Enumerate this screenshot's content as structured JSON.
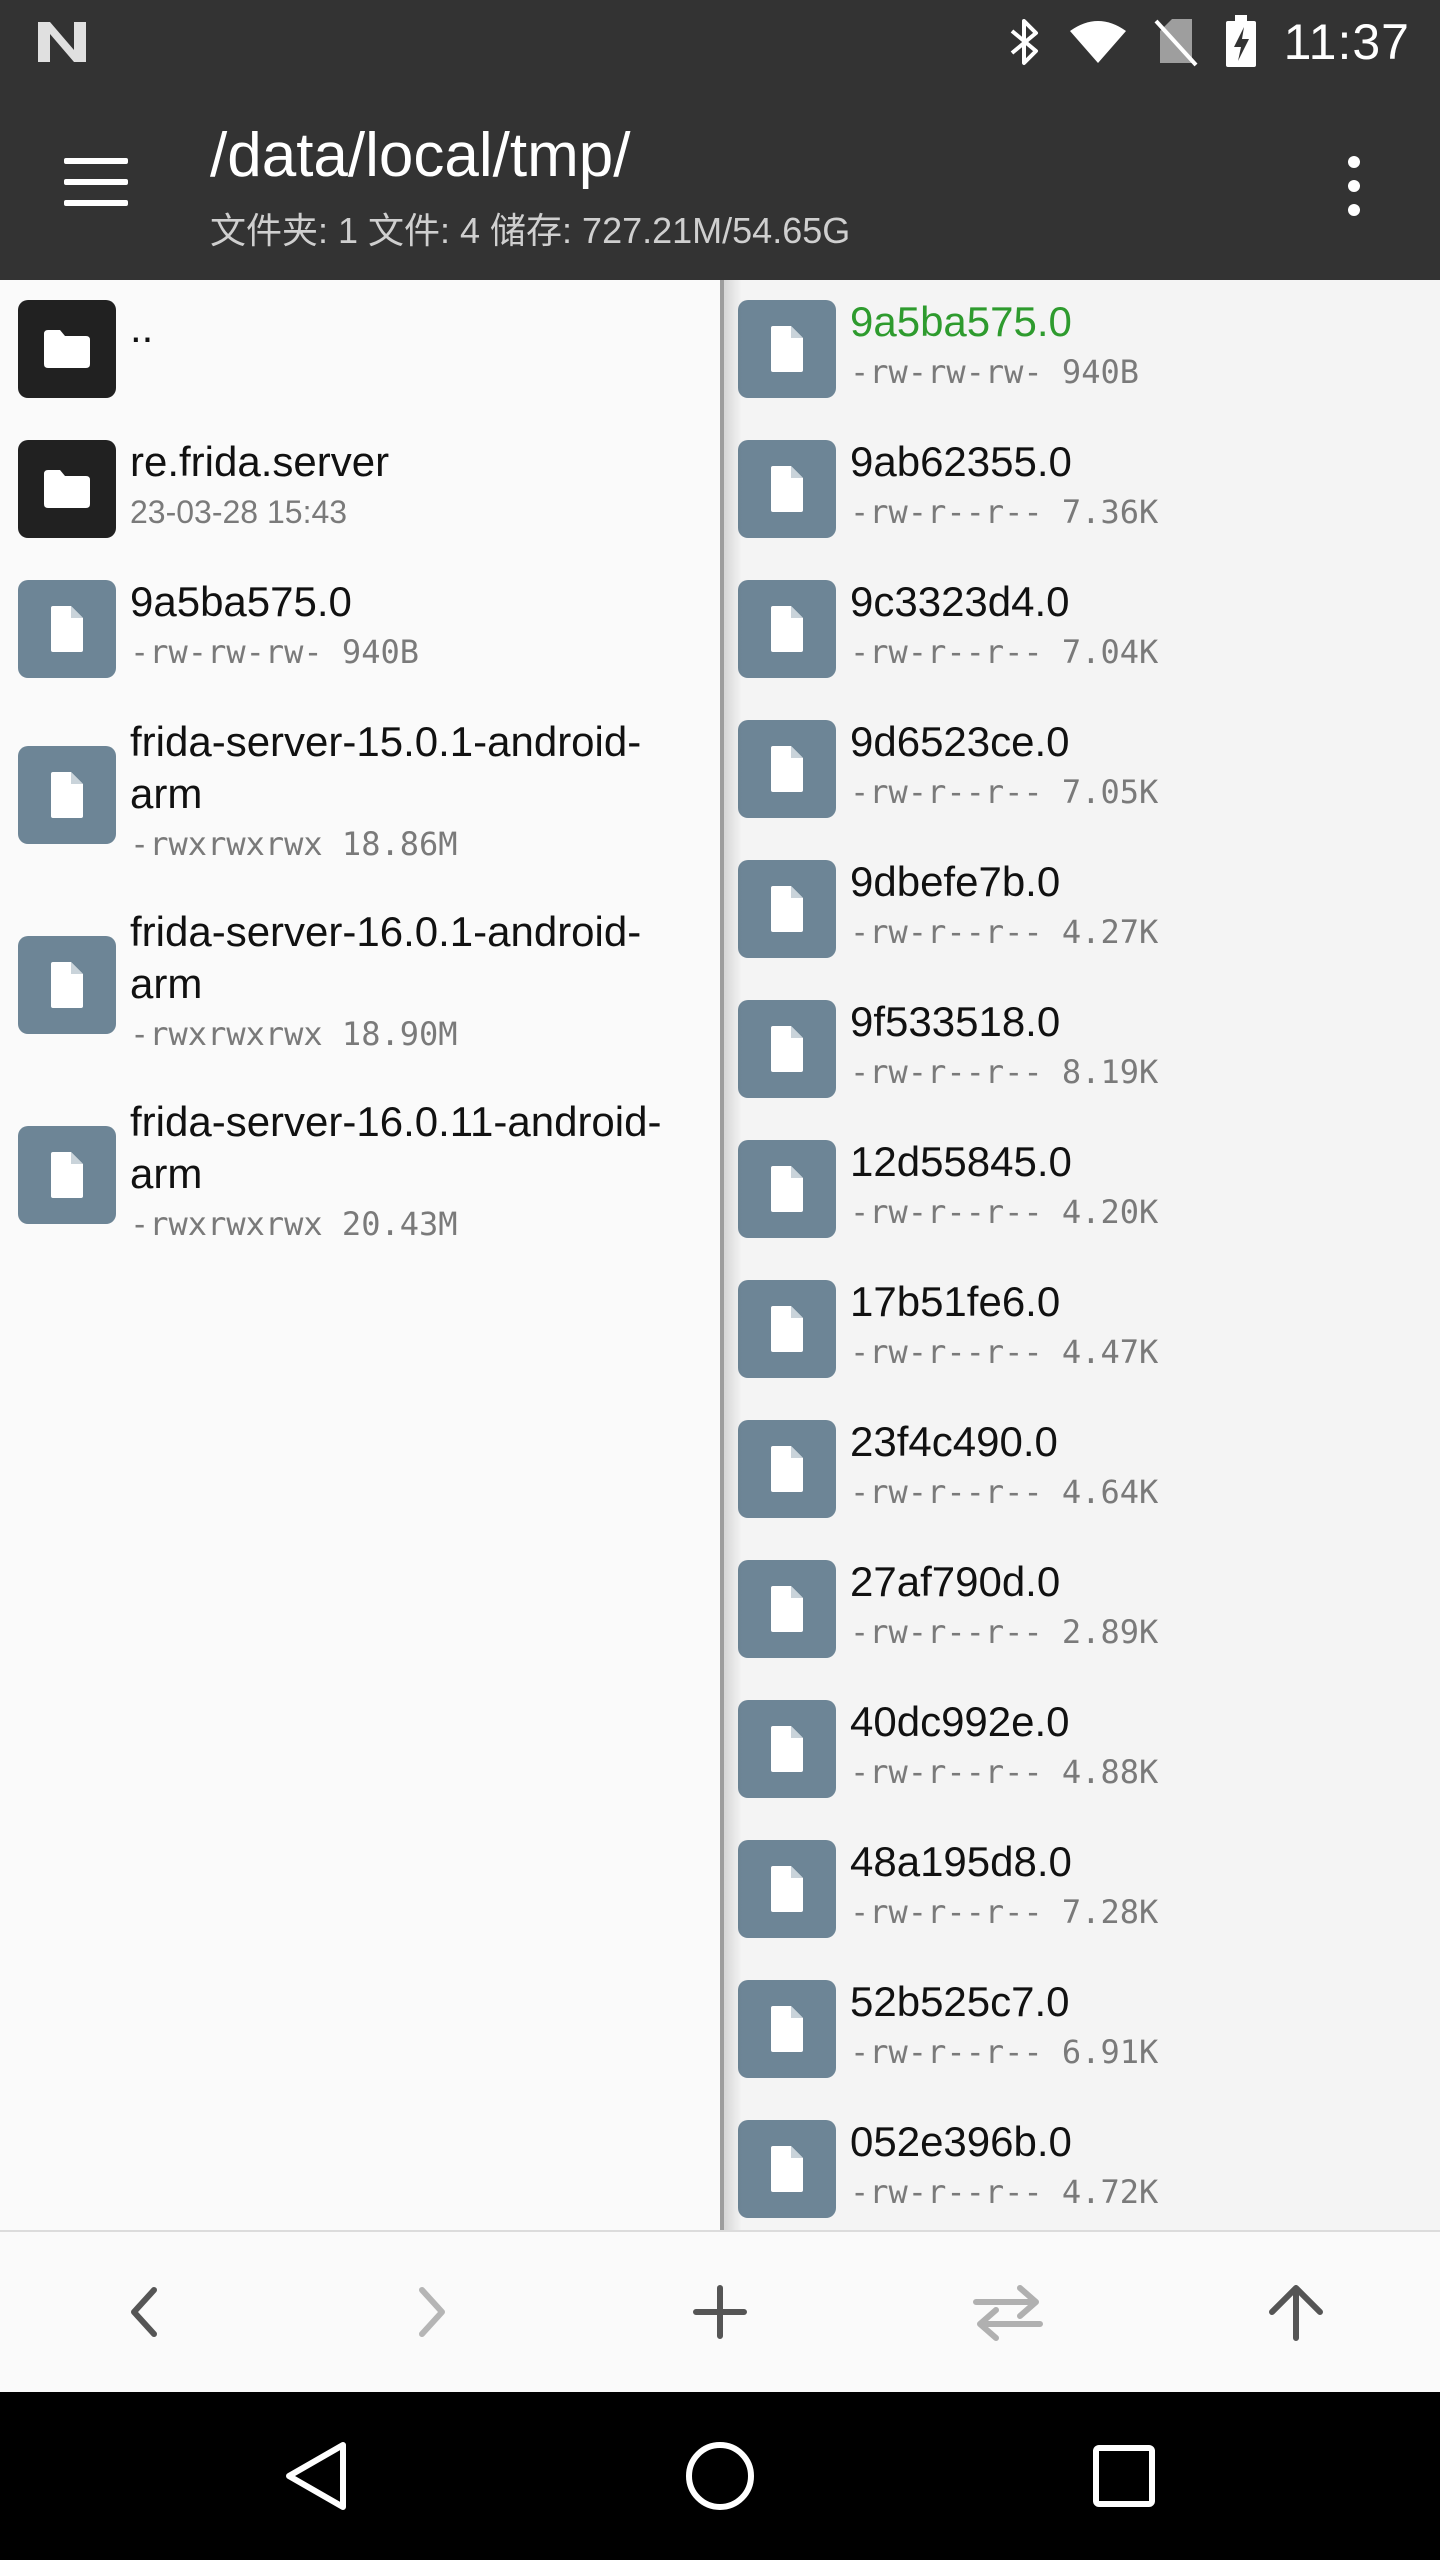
{
  "status_bar": {
    "time": "11:37",
    "icons": [
      "notification-n-icon",
      "bluetooth-icon",
      "wifi-icon",
      "no-sim-icon",
      "battery-charging-icon"
    ]
  },
  "app_bar": {
    "title": "/data/local/tmp/",
    "subtitle": "文件夹: 1  文件: 4  储存: 727.21M/54.65G",
    "menu_icon": "menu-icon",
    "overflow_icon": "more-vert-icon"
  },
  "left_pane": {
    "items": [
      {
        "type": "folder",
        "name": "..",
        "meta": ""
      },
      {
        "type": "folder",
        "name": "re.frida.server",
        "meta": "23-03-28 15:43"
      },
      {
        "type": "file",
        "name": "9a5ba575.0",
        "meta": "-rw-rw-rw- 940B"
      },
      {
        "type": "file",
        "name": "frida-server-15.0.1-android-arm",
        "meta": "-rwxrwxrwx 18.86M"
      },
      {
        "type": "file",
        "name": "frida-server-16.0.1-android-arm",
        "meta": "-rwxrwxrwx 18.90M"
      },
      {
        "type": "file",
        "name": "frida-server-16.0.11-android-arm",
        "meta": "-rwxrwxrwx 20.43M"
      }
    ]
  },
  "right_pane": {
    "items": [
      {
        "name": "9a5ba575.0",
        "meta": "-rw-rw-rw- 940B",
        "selected": true
      },
      {
        "name": "9ab62355.0",
        "meta": "-rw-r--r-- 7.36K"
      },
      {
        "name": "9c3323d4.0",
        "meta": "-rw-r--r-- 7.04K"
      },
      {
        "name": "9d6523ce.0",
        "meta": "-rw-r--r-- 7.05K"
      },
      {
        "name": "9dbefe7b.0",
        "meta": "-rw-r--r-- 4.27K"
      },
      {
        "name": "9f533518.0",
        "meta": "-rw-r--r-- 8.19K"
      },
      {
        "name": "12d55845.0",
        "meta": "-rw-r--r-- 4.20K"
      },
      {
        "name": "17b51fe6.0",
        "meta": "-rw-r--r-- 4.47K"
      },
      {
        "name": "23f4c490.0",
        "meta": "-rw-r--r-- 4.64K"
      },
      {
        "name": "27af790d.0",
        "meta": "-rw-r--r-- 2.89K"
      },
      {
        "name": "40dc992e.0",
        "meta": "-rw-r--r-- 4.88K"
      },
      {
        "name": "48a195d8.0",
        "meta": "-rw-r--r-- 7.28K"
      },
      {
        "name": "52b525c7.0",
        "meta": "-rw-r--r-- 6.91K"
      },
      {
        "name": "052e396b.0",
        "meta": "-rw-r--r-- 4.72K"
      }
    ]
  },
  "toolbar": {
    "buttons": [
      "back-icon",
      "forward-icon",
      "add-icon",
      "swap-panes-icon",
      "up-icon"
    ]
  },
  "nav_bar": {
    "buttons": [
      "nav-back-icon",
      "nav-home-icon",
      "nav-recents-icon"
    ]
  },
  "colors": {
    "bar_background": "#333333",
    "selected_text": "#2e9b2e",
    "file_icon_tile": "#6d8596",
    "folder_icon_tile": "#212121"
  }
}
